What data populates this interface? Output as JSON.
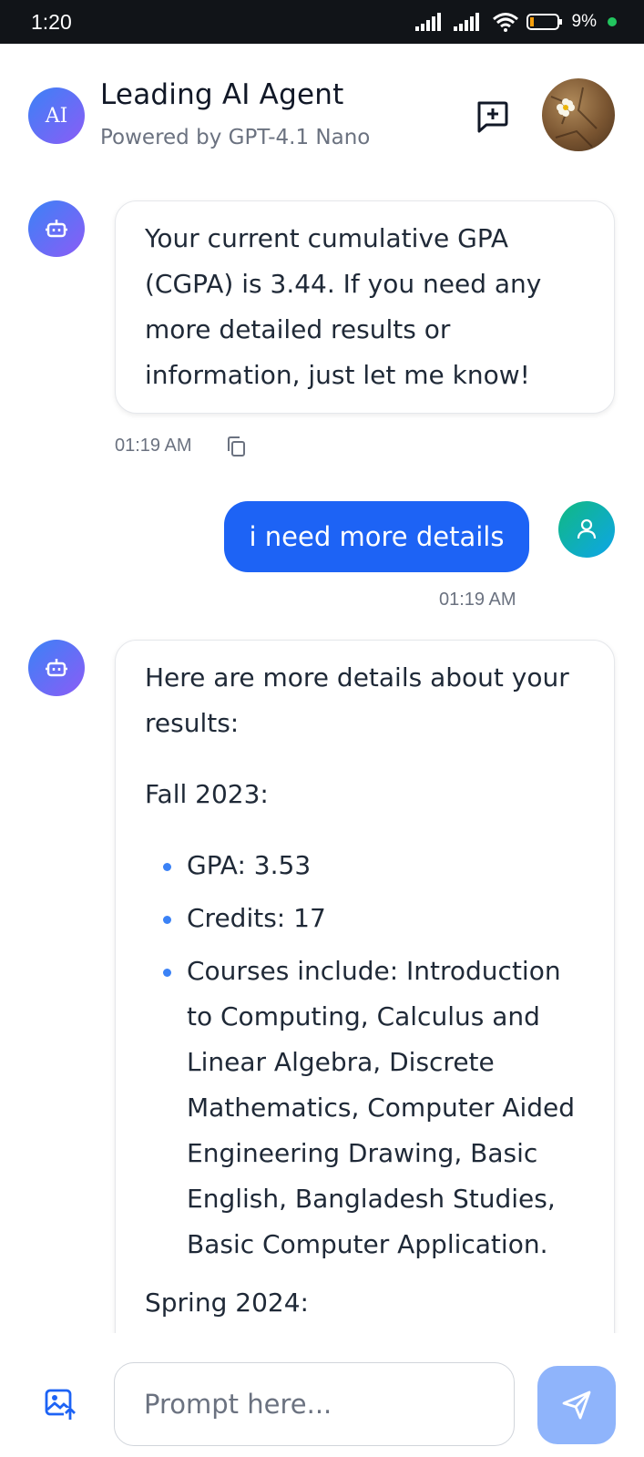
{
  "status_bar": {
    "time": "1:20",
    "battery": "9%"
  },
  "header": {
    "avatar_text": "AI",
    "title": "Leading AI Agent",
    "subtitle": "Powered by GPT-4.1 Nano"
  },
  "messages": {
    "bot1": {
      "text": "Your current cumulative GPA (CGPA) is 3.44. If you need any more detailed results or information, just let me know!",
      "time": "01:19 AM"
    },
    "user1": {
      "text": "i need more details",
      "time": "01:19 AM"
    },
    "bot2": {
      "intro": "Here are more details about your results:",
      "section1": "Fall 2023:",
      "items": [
        "GPA: 3.53",
        "Credits: 17",
        "Courses include: Introduction to Computing, Calculus and Linear Algebra, Discrete Mathematics, Computer Aided Engineering Drawing, Basic English, Bangladesh Studies, Basic Computer Application."
      ],
      "section2": "Spring 2024:"
    }
  },
  "input": {
    "placeholder": "Prompt here..."
  },
  "colors": {
    "accent": "#1d63f5",
    "send_button": "#8fb4fb",
    "bullet": "#3b82f6"
  },
  "icons": {
    "new_chat": "message-plus-icon",
    "copy": "copy-icon",
    "image_upload": "image-upload-icon",
    "send": "send-icon",
    "bot": "robot-icon",
    "user": "user-icon"
  }
}
